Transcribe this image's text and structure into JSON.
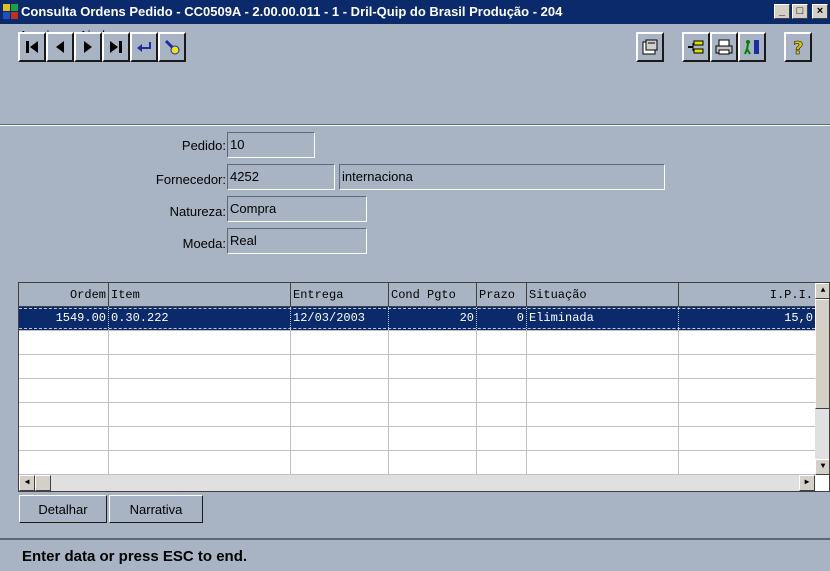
{
  "window": {
    "title": "Consulta Ordens Pedido - CC0509A - 2.00.00.011 - 1 - Dril-Quip do Brasil Produção - 204",
    "minimize_glyph": "_",
    "restore_glyph": "□",
    "close_glyph": "×"
  },
  "menu": {
    "items": [
      {
        "label": "Arquivo"
      },
      {
        "label": "Ajuda"
      }
    ]
  },
  "toolbar": {
    "buttons": [
      {
        "icon": "first-record-icon"
      },
      {
        "icon": "previous-record-icon"
      },
      {
        "icon": "next-record-icon"
      },
      {
        "icon": "last-record-icon"
      },
      {
        "icon": "return-icon"
      },
      {
        "icon": "search-icon"
      },
      {
        "icon": "properties-icon"
      },
      {
        "icon": "tree-icon"
      },
      {
        "icon": "print-icon"
      },
      {
        "icon": "exit-icon"
      },
      {
        "icon": "help-icon"
      }
    ]
  },
  "form": {
    "pedido_label": "Pedido:",
    "pedido_value": "10",
    "fornecedor_label": "Fornecedor:",
    "fornecedor_code": "4252",
    "fornecedor_name": "internaciona",
    "natureza_label": "Natureza:",
    "natureza_value": "Compra",
    "moeda_label": "Moeda:",
    "moeda_value": "Real"
  },
  "grid": {
    "columns": [
      "Ordem",
      "Item",
      "Entrega",
      "Cond Pgto",
      "Prazo",
      "Situação",
      "I.P.I."
    ],
    "rows": [
      {
        "ordem": "1549.00",
        "item": "0.30.222",
        "entrega": "12/03/2003",
        "cond_pgto": "20",
        "prazo": "0",
        "situacao": "Eliminada",
        "ipi": "15,0"
      }
    ]
  },
  "buttons": {
    "detalhar": "Detalhar",
    "narrativa": "Narrativa"
  },
  "status": {
    "text": "Enter data or press ESC to end."
  },
  "colors": {
    "background": "#a8b4c4",
    "titlebar": "#0a2a6b",
    "selection": "#0a2a6b"
  }
}
